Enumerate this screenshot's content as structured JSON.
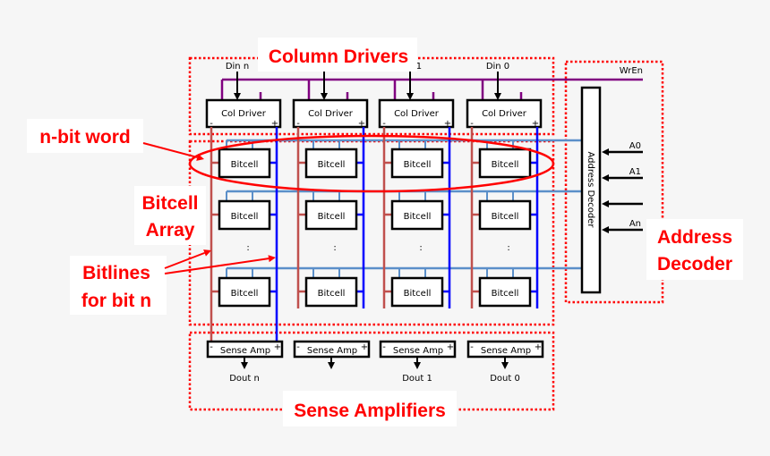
{
  "titles": {
    "column_drivers": "Column Drivers",
    "sense_amplifiers": "Sense Amplifiers"
  },
  "callouts": {
    "n_bit_word": "n-bit word",
    "bitcell_array_line1": "Bitcell",
    "bitcell_array_line2": "Array",
    "bitlines_line1": "Bitlines",
    "bitlines_line2": "for bit n",
    "address_decoder_line1": "Address",
    "address_decoder_line2": "Decoder"
  },
  "signals": {
    "write_enable": "WrEn",
    "din": [
      "Din n",
      "",
      "Din 1",
      "Din 0"
    ],
    "dout": [
      "Dout n",
      "",
      "Dout 1",
      "Dout 0"
    ],
    "address": [
      "A0",
      "A1",
      "",
      "An"
    ]
  },
  "blocks": {
    "col_driver": "Col Driver",
    "bitcell": "Bitcell",
    "sense_amp": "Sense Amp",
    "address_decoder": "Address Decoder",
    "ellipsis": ":",
    "minus": "-",
    "plus": "+"
  },
  "colors": {
    "callout_red": "#ff0000",
    "wordline": "#5b8fc9",
    "bitline": "#0000ff",
    "bitline_bar": "#c0504d",
    "write_enable": "#800080"
  }
}
